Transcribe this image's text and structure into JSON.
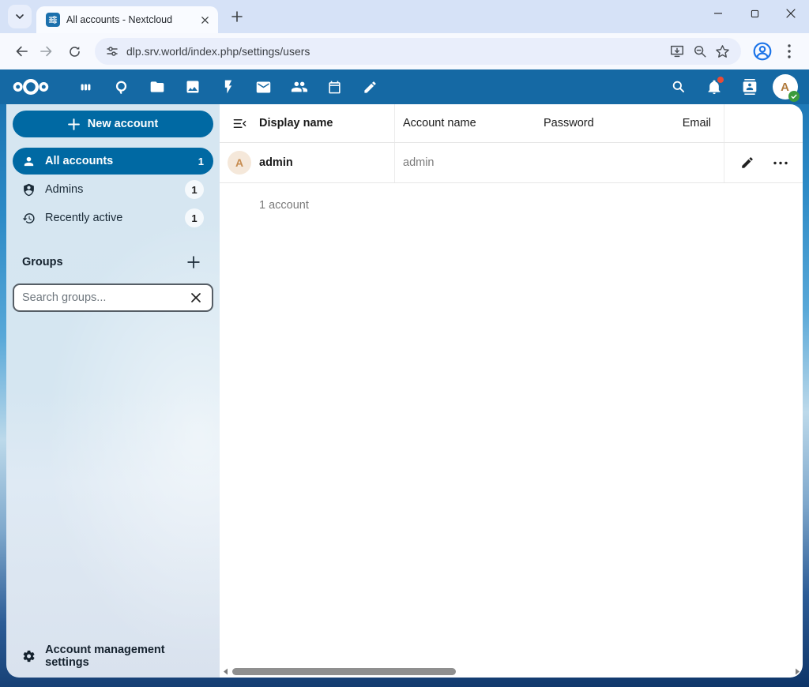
{
  "browser": {
    "tab_title": "All accounts - Nextcloud",
    "url": "dlp.srv.world/index.php/settings/users",
    "window_controls": [
      "minimize",
      "maximize",
      "close"
    ]
  },
  "nc_header": {
    "app_icons": [
      "dashboard",
      "search",
      "files",
      "photos",
      "activity",
      "mail",
      "contacts",
      "calendar",
      "notes"
    ],
    "right_icons": [
      "unified-search",
      "notifications",
      "contacts-menu",
      "avatar"
    ],
    "avatar_letter": "A",
    "has_notification_dot": true
  },
  "sidebar": {
    "new_account_label": "New account",
    "items": [
      {
        "label": "All accounts",
        "count": "1",
        "selected": true
      },
      {
        "label": "Admins",
        "count": "1",
        "selected": false
      },
      {
        "label": "Recently active",
        "count": "1",
        "selected": false
      }
    ],
    "groups_label": "Groups",
    "search_placeholder": "Search groups...",
    "footer_label": "Account management settings"
  },
  "table": {
    "headers": {
      "display_name": "Display name",
      "account_name": "Account name",
      "password": "Password",
      "email": "Email"
    },
    "rows": [
      {
        "avatar_letter": "A",
        "display_name": "admin",
        "account_name": "admin",
        "password": "",
        "email": ""
      }
    ],
    "count_label": "1 account"
  },
  "colors": {
    "accent_blue": "#0069a3",
    "header_blue": "#1569a4",
    "status_green": "#3b9b3b",
    "notification_red": "#ea4b35",
    "avatar_orange": "#c78c50"
  }
}
